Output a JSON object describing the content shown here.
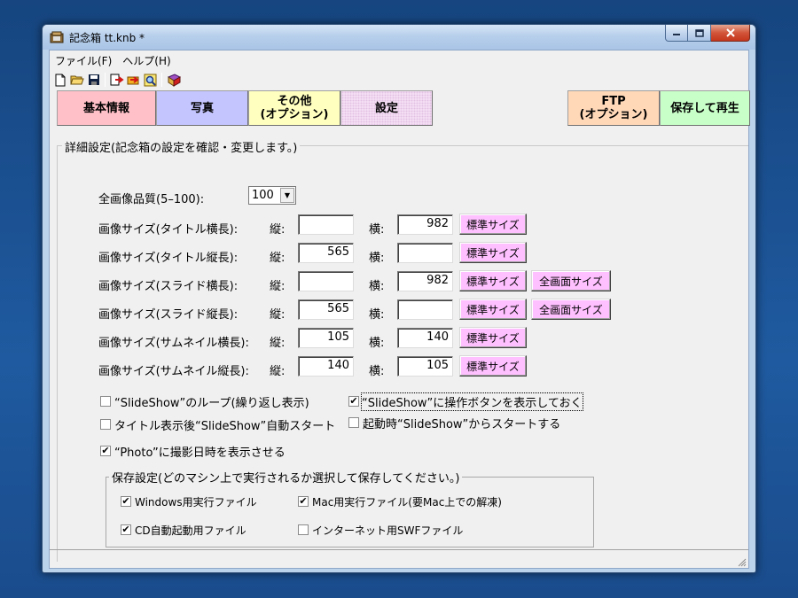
{
  "window": {
    "title": "記念箱 tt.knb *",
    "min_icon": "minimize-icon",
    "max_icon": "maximize-icon",
    "close_icon": "close-icon"
  },
  "menu": [
    "ファイル(F)",
    "ヘルプ(H)"
  ],
  "toolbar": [
    "new-file-icon",
    "open-folder-icon",
    "save-disk-icon",
    "export-icon",
    "open-icon",
    "preview-icon",
    "book-icon"
  ],
  "tabs": {
    "basic": "基本情報",
    "photo": "写真",
    "other_line1": "その他",
    "other_line2": "(オプション)",
    "settings": "設定",
    "ftp_line1": "FTP",
    "ftp_line2": "(オプション)",
    "save_play": "保存して再生"
  },
  "detail": {
    "legend": "詳細設定(記念箱の設定を確認・変更します。)",
    "quality_label": "全画像品質(5–100):",
    "quality_value": "100",
    "vert_label": "縦:",
    "horiz_label": "横:",
    "rows": [
      {
        "label": "画像サイズ(タイトル横長):",
        "vert": "",
        "horiz": "982",
        "std": "標準サイズ",
        "full": ""
      },
      {
        "label": "画像サイズ(タイトル縦長):",
        "vert": "565",
        "horiz": "",
        "std": "標準サイズ",
        "full": ""
      },
      {
        "label": "画像サイズ(スライド横長):",
        "vert": "",
        "horiz": "982",
        "std": "標準サイズ",
        "full": "全画面サイズ"
      },
      {
        "label": "画像サイズ(スライド縦長):",
        "vert": "565",
        "horiz": "",
        "std": "標準サイズ",
        "full": "全画面サイズ"
      },
      {
        "label": "画像サイズ(サムネイル横長):",
        "vert": "105",
        "horiz": "140",
        "std": "標準サイズ",
        "full": ""
      },
      {
        "label": "画像サイズ(サムネイル縦長):",
        "vert": "140",
        "horiz": "105",
        "std": "標準サイズ",
        "full": ""
      }
    ],
    "options": {
      "loop": {
        "label": "“SlideShow”のループ(繰り返し表示)",
        "checked": false
      },
      "show_buttons": {
        "label": "“SlideShow”に操作ボタンを表示しておく",
        "checked": true
      },
      "autostart": {
        "label": "タイトル表示後“SlideShow”自動スタート",
        "checked": false
      },
      "start_at_launch": {
        "label": "起動時“SlideShow”からスタートする",
        "checked": false
      },
      "show_date": {
        "label": "“Photo”に撮影日時を表示させる",
        "checked": true
      }
    }
  },
  "save_settings": {
    "legend": "保存設定(どのマシン上で実行されるか選択して保存してください。)",
    "windows_exe": {
      "label": "Windows用実行ファイル",
      "checked": true
    },
    "mac_exe": {
      "label": "Mac用実行ファイル(要Mac上での解凍)",
      "checked": true
    },
    "cd_autorun": {
      "label": "CD自動起動用ファイル",
      "checked": true
    },
    "internet_swf": {
      "label": "インターネット用SWFファイル",
      "checked": false
    }
  }
}
